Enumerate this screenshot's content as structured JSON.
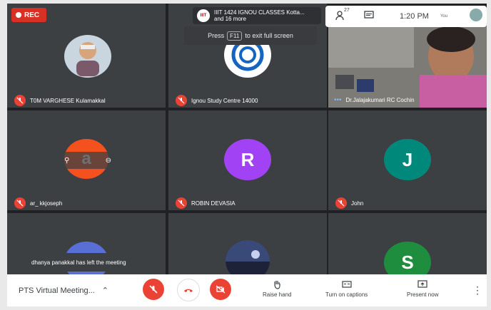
{
  "rec_label": "REC",
  "notification": {
    "logo_text": "IIIT",
    "line1": "IIIT 1424 IGNOU CLASSES Kotta...",
    "line2": "and 16 more"
  },
  "fullscreen_hint": {
    "before": "Press",
    "key": "F11",
    "after": "to exit full screen"
  },
  "status": {
    "people_count": "27",
    "time": "1:20 PM",
    "you_label": "You"
  },
  "participants": [
    {
      "name": "T0M VARGHESE Kulamakkal"
    },
    {
      "name": "Ignou Study Centre 14000"
    },
    {
      "name": "Dr.Jalajakumari RC Cochin"
    },
    {
      "name": "ar_ kkjoseph",
      "initial": "a"
    },
    {
      "name": "ROBIN DEVASIA",
      "initial": "R"
    },
    {
      "name": "John",
      "initial": "J"
    },
    {
      "initial": "S"
    }
  ],
  "toast": "dhanya panakkal has left the meeting",
  "bottom": {
    "meeting_name": "PTS Virtual Meeting...",
    "raise_hand": "Raise hand",
    "captions": "Turn on captions",
    "present": "Present now"
  },
  "colors": {
    "mute_red": "#ea4335",
    "avatar_orange": "#f4511e",
    "avatar_purple": "#a142f4",
    "avatar_teal": "#00897b",
    "avatar_green": "#1e8e3e"
  }
}
